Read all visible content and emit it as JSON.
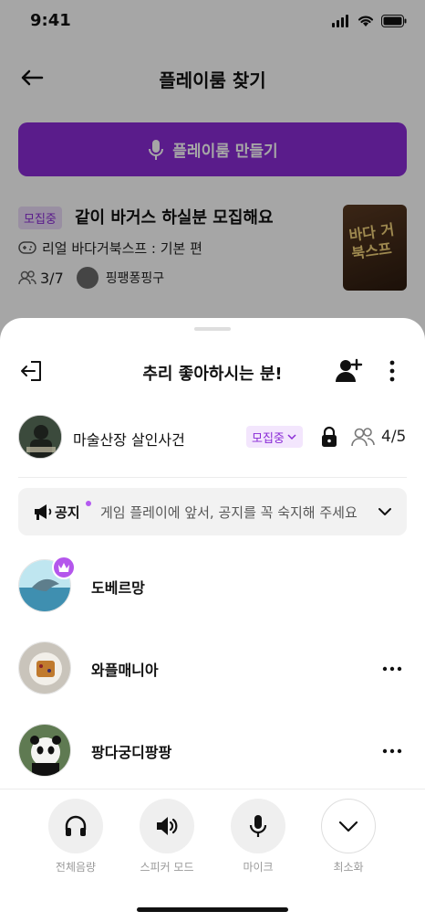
{
  "status_bar": {
    "time": "9:41"
  },
  "background": {
    "title": "플레이룸 찾기",
    "create_button_label": "플레이룸 만들기",
    "room": {
      "badge": "모집중",
      "title": "같이 바거스 하실분 모집해요",
      "game": "리얼 바다거북스프 : 기본 편",
      "count": "3/7",
      "host": "핑팽퐁핑구",
      "thumb_text": "바다 거북스프"
    }
  },
  "sheet": {
    "title": "추리 좋아하시는 분!",
    "game_name": "마술산장 살인사건",
    "status": "모집중",
    "people_count": "4/5",
    "notice": {
      "label": "공지",
      "text": "게임 플레이에 앞서, 공지를 꼭 숙지해 주세요"
    },
    "members": [
      {
        "name": "도베르망",
        "host": true
      },
      {
        "name": "와플매니아",
        "host": false
      },
      {
        "name": "팡다궁디팡팡",
        "host": false
      }
    ],
    "controls": [
      {
        "label": "전체음량",
        "icon": "headphones-icon"
      },
      {
        "label": "스피커 모드",
        "icon": "speaker-icon"
      },
      {
        "label": "마이크",
        "icon": "mic-icon"
      },
      {
        "label": "최소화",
        "icon": "chevron-down-icon"
      }
    ]
  },
  "colors": {
    "accent": "#8a2bd6",
    "accent_light": "#f3e6fd",
    "dim_overlay": "rgba(0,0,0,0.35)"
  }
}
